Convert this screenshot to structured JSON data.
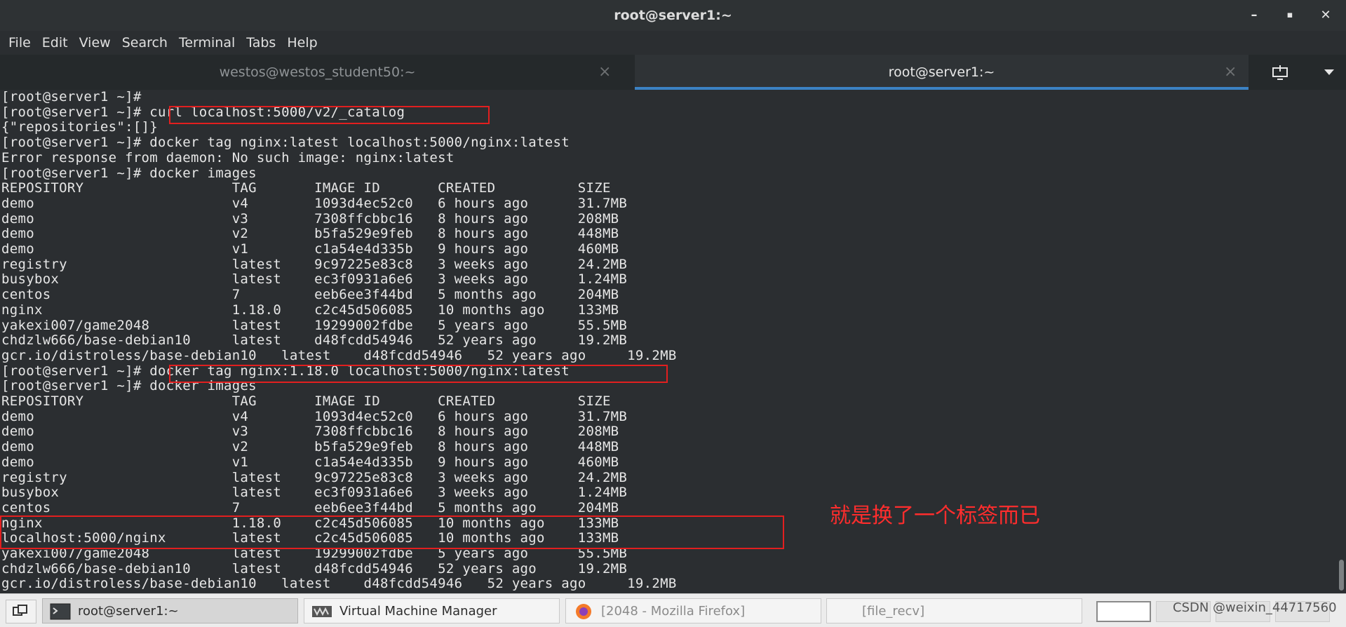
{
  "window": {
    "title": "root@server1:~",
    "minimize_label": "–",
    "maximize_label": "▪",
    "close_label": "✕"
  },
  "menubar": {
    "items": [
      "File",
      "Edit",
      "View",
      "Search",
      "Terminal",
      "Tabs",
      "Help"
    ]
  },
  "tabs": [
    {
      "label": "westos@westos_student50:~",
      "active": false
    },
    {
      "label": "root@server1:~",
      "active": true
    }
  ],
  "tab_icons": {
    "new_tab": "new-tab-icon",
    "dropdown": "chevron-down-icon"
  },
  "terminal": {
    "lines": [
      "[root@server1 ~]#",
      "[root@server1 ~]# curl localhost:5000/v2/_catalog",
      "{\"repositories\":[]}",
      "[root@server1 ~]# docker tag nginx:latest localhost:5000/nginx:latest",
      "Error response from daemon: No such image: nginx:latest",
      "[root@server1 ~]# docker images",
      "REPOSITORY                  TAG       IMAGE ID       CREATED          SIZE",
      "demo                        v4        1093d4ec52c0   6 hours ago      31.7MB",
      "demo                        v3        7308ffcbbc16   8 hours ago      208MB",
      "demo                        v2        b5fa529e9feb   8 hours ago      448MB",
      "demo                        v1        c1a54e4d335b   9 hours ago      460MB",
      "registry                    latest    9c97225e83c8   3 weeks ago      24.2MB",
      "busybox                     latest    ec3f0931a6e6   3 weeks ago      1.24MB",
      "centos                      7         eeb6ee3f44bd   5 months ago     204MB",
      "nginx                       1.18.0    c2c45d506085   10 months ago    133MB",
      "yakexi007/game2048          latest    19299002fdbe   5 years ago      55.5MB",
      "chdzlw666/base-debian10     latest    d48fcdd54946   52 years ago     19.2MB",
      "gcr.io/distroless/base-debian10   latest    d48fcdd54946   52 years ago     19.2MB",
      "[root@server1 ~]# docker tag nginx:1.18.0 localhost:5000/nginx:latest",
      "[root@server1 ~]# docker images",
      "REPOSITORY                  TAG       IMAGE ID       CREATED          SIZE",
      "demo                        v4        1093d4ec52c0   6 hours ago      31.7MB",
      "demo                        v3        7308ffcbbc16   8 hours ago      208MB",
      "demo                        v2        b5fa529e9feb   8 hours ago      448MB",
      "demo                        v1        c1a54e4d335b   9 hours ago      460MB",
      "registry                    latest    9c97225e83c8   3 weeks ago      24.2MB",
      "busybox                     latest    ec3f0931a6e6   3 weeks ago      1.24MB",
      "centos                      7         eeb6ee3f44bd   5 months ago     204MB",
      "nginx                       1.18.0    c2c45d506085   10 months ago    133MB",
      "localhost:5000/nginx        latest    c2c45d506085   10 months ago    133MB",
      "yakexi007/game2048          latest    19299002fdbe   5 years ago      55.5MB",
      "chdzlw666/base-debian10     latest    d48fcdd54946   52 years ago     19.2MB",
      "gcr.io/distroless/base-debian10   latest    d48fcdd54946   52 years ago     19.2MB"
    ],
    "annotation": "就是换了一个标签而已",
    "highlight_color": "#e21f1f"
  },
  "taskbar": {
    "items": [
      {
        "label": "root@server1:~",
        "icon": "terminal-icon"
      },
      {
        "label": "Virtual Machine Manager",
        "icon": "virt-manager-icon"
      },
      {
        "label": "[2048 - Mozilla Firefox]",
        "icon": "firefox-icon"
      },
      {
        "label": "[file_recv]",
        "icon": ""
      }
    ],
    "show_desktop_icon": "show-desktop-icon"
  },
  "watermark": "CSDN @weixin_44717560"
}
